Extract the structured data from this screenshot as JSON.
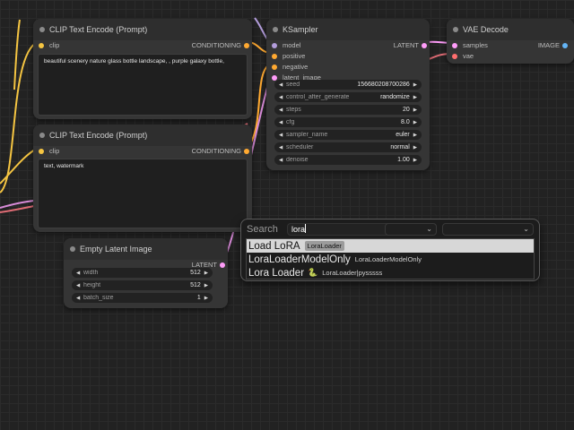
{
  "colors": {
    "clip": "#f5c542",
    "conditioning": "#ffa931",
    "model": "#b39ddb",
    "latent": "#ff9cf9",
    "vae": "#ff6e6e",
    "image": "#64b5f6",
    "link_red": "#e06c75",
    "link_pink": "#d88bd8"
  },
  "nodes": {
    "clip_pos": {
      "title": "CLIP Text Encode (Prompt)",
      "input": "clip",
      "output": "CONDITIONING",
      "text": "beautiful scenery nature glass bottle landscape, , purple galaxy bottle,"
    },
    "clip_neg": {
      "title": "CLIP Text Encode (Prompt)",
      "input": "clip",
      "output": "CONDITIONING",
      "text": "text, watermark"
    },
    "ksampler": {
      "title": "KSampler",
      "inputs": [
        "model",
        "positive",
        "negative",
        "latent_image"
      ],
      "output": "LATENT",
      "widgets": [
        {
          "name": "seed",
          "value": "156680208700286"
        },
        {
          "name": "control_after_generate",
          "value": "randomize"
        },
        {
          "name": "steps",
          "value": "20"
        },
        {
          "name": "cfg",
          "value": "8.0"
        },
        {
          "name": "sampler_name",
          "value": "euler"
        },
        {
          "name": "scheduler",
          "value": "normal"
        },
        {
          "name": "denoise",
          "value": "1.00"
        }
      ]
    },
    "vae_decode": {
      "title": "VAE Decode",
      "inputs": [
        "samples",
        "vae"
      ],
      "output": "IMAGE"
    },
    "empty_latent": {
      "title": "Empty Latent Image",
      "output": "LATENT",
      "widgets": [
        {
          "name": "width",
          "value": "512"
        },
        {
          "name": "height",
          "value": "512"
        },
        {
          "name": "batch_size",
          "value": "1"
        }
      ]
    }
  },
  "search": {
    "label": "Search",
    "query": "lora",
    "results": [
      {
        "name": "Load LoRA",
        "sub": "LoraLoader",
        "selected": true
      },
      {
        "name": "LoraLoaderModelOnly",
        "sub": "LoraLoaderModelOnly",
        "selected": false
      },
      {
        "name": "Lora Loader",
        "icon": "snake-icon",
        "sub": "LoraLoader|pysssss",
        "selected": false
      }
    ]
  }
}
